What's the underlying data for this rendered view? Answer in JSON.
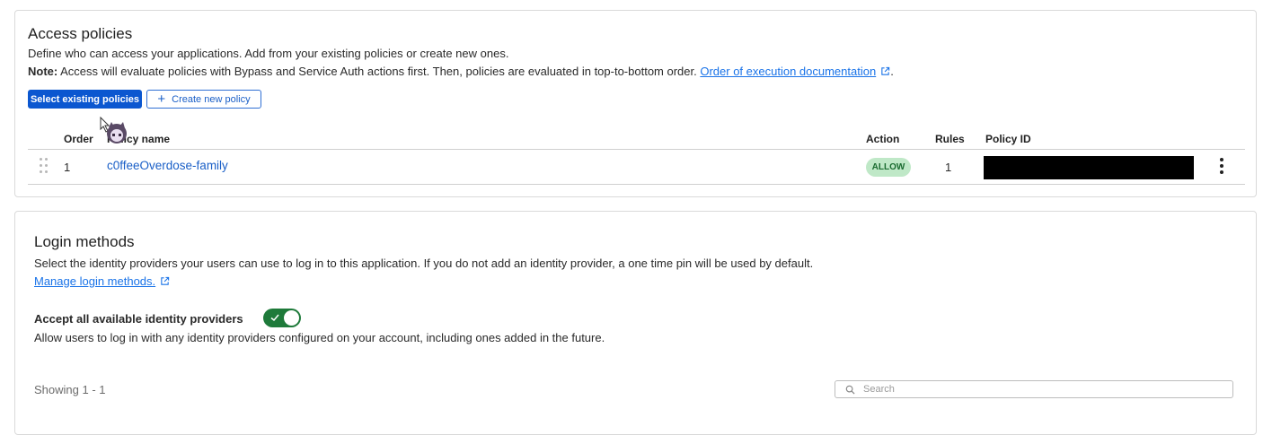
{
  "access_policies": {
    "title": "Access policies",
    "description": "Define who can access your applications. Add from your existing policies or create new ones.",
    "note_label": "Note:",
    "note_text": " Access will evaluate policies with Bypass and Service Auth actions first. Then, policies are evaluated in top-to-bottom order.",
    "note_link": "Order of execution documentation",
    "note_end": ".",
    "select_button": "Select existing policies",
    "create_button": "Create new policy",
    "columns": {
      "order": "Order",
      "policy_name": "Policy name",
      "action": "Action",
      "rules": "Rules",
      "policy_id": "Policy ID"
    },
    "rows": [
      {
        "order": "1",
        "name": "c0ffeeOverdose-family",
        "action": "ALLOW",
        "rules": "1"
      }
    ]
  },
  "login_methods": {
    "title": "Login methods",
    "description": "Select the identity providers your users can use to log in to this application. If you do not add an identity provider, a one time pin will be used by default.",
    "manage_link": "Manage login methods.",
    "accept_label": "Accept all available identity providers",
    "accept_enabled": true,
    "accept_description": "Allow users to log in with any identity providers configured on your account, including ones added in the future.",
    "showing": "Showing 1 - 1",
    "search_placeholder": "Search"
  },
  "colors": {
    "primary": "#0b57d0",
    "link": "#1a5fc7",
    "allow_badge_bg": "#bfe8c7",
    "toggle_on": "#1e7a3a"
  },
  "icons": [
    "external-link-icon",
    "plus-icon",
    "drag-handle-icon",
    "kebab-menu-icon",
    "check-icon",
    "search-icon"
  ]
}
